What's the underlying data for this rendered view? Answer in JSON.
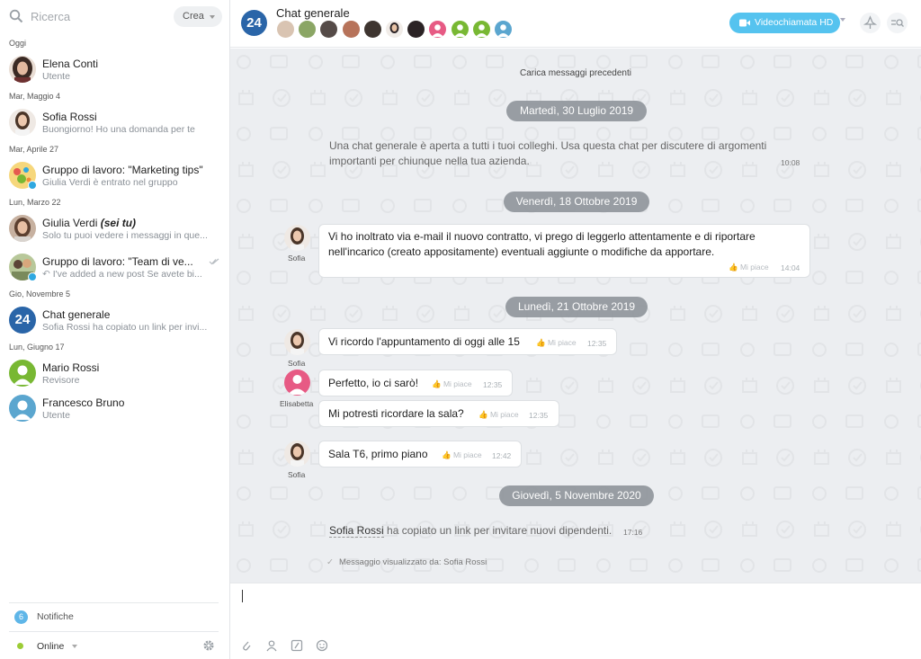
{
  "sidebar": {
    "search_placeholder": "Ricerca",
    "create_label": "Crea",
    "sections": [
      {
        "date": "Oggi"
      },
      {
        "date": "Mar, Maggio 4"
      },
      {
        "date": "Mar, Aprile 27"
      },
      {
        "date": "Lun, Marzo 22"
      },
      {
        "date": "Gio, Novembre 5"
      },
      {
        "date": "Lun, Giugno 17"
      }
    ],
    "chats": [
      {
        "name": "Elena Conti",
        "sub": "Utente",
        "avatar_color": "#6b4a3a"
      },
      {
        "name": "Sofia Rossi",
        "sub": "Buongiorno! Ho una domanda per te",
        "avatar_color": "#d8c8b8"
      },
      {
        "name": "Gruppo di lavoro: \"Marketing tips\"",
        "sub": "Giulia Verdi è entrato nel gruppo",
        "avatar_color": "#f3d27a"
      },
      {
        "name": "Giulia Verdi",
        "name_suffix": "(sei tu)",
        "sub": "Solo tu puoi vedere i messaggi in que...",
        "avatar_color": "#a98a78"
      },
      {
        "name": "Gruppo di lavoro: \"Team di ve...",
        "sub": "I've added a new post Se avete bi...",
        "avatar_color": "#c9b38d"
      },
      {
        "name": "Chat generale",
        "sub": "Sofia Rossi ha copiato un link per invi...",
        "avatar_color": "#2a65a8",
        "avatar_text": "24"
      },
      {
        "name": "Mario Rossi",
        "sub": "Revisore",
        "avatar_color": "#78b833"
      },
      {
        "name": "Francesco Bruno",
        "sub": "Utente",
        "avatar_color": "#5ba6cf"
      }
    ],
    "notifications_count": "6",
    "notifications_label": "Notifiche",
    "status_label": "Online"
  },
  "header": {
    "logo_text": "24",
    "title": "Chat generale",
    "video_label": "Videochiamata HD",
    "member_colors": [
      "#d9c4b2",
      "#8ba665",
      "#554b48",
      "#b7735a",
      "#3e3530",
      "#2e2828",
      "#2b2325",
      "#e75a84",
      "#78b833",
      "#78b833",
      "#5ba6cf"
    ]
  },
  "messages": {
    "load_prev": "Carica messaggi precedenti",
    "dates": [
      "Martedì, 30 Luglio 2019",
      "Venerdì, 18 Ottobre 2019",
      "Lunedì, 21 Ottobre 2019",
      "Giovedì, 5 Novembre 2020"
    ],
    "system_intro_1": "Una chat generale è aperta a tutti i tuoi colleghi. Usa questa chat per discutere di argomenti",
    "system_intro_2": "importanti per chiunque nella tua azienda.",
    "system_intro_time": "10:08",
    "m1_line1": "Vi ho inoltrato via e-mail il nuovo contratto, vi prego di leggerlo attentamente e di riportare",
    "m1_line2": "nell'incarico (creato appositamente) eventuali aggiunte o modifiche da apportare.",
    "m1_time": "14:04",
    "m2_text": "Vi ricordo l'appuntamento di oggi alle 15",
    "m2_time": "12:35",
    "m3_text": "Perfetto, io ci sarò!",
    "m3_time": "12:35",
    "m4_text": "Mi potresti ricordare la sala?",
    "m4_time": "12:35",
    "m5_text": "Sala T6, primo piano",
    "m5_time": "12:42",
    "like_label": "Mi piace",
    "sender_sofia": "Sofia",
    "sender_elisabetta": "Elisabetta",
    "sys_link_name": "Sofia Rossi",
    "sys_link_rest": "ha copiato un link per invitare nuovi dipendenti.",
    "sys_link_time": "17:16",
    "seen_label": "Messaggio visualizzato da: Sofia Rossi"
  },
  "colors": {
    "accent": "#55c3ef",
    "brand": "#2a65a8",
    "online": "#9ccc36",
    "date_pill": "#8f959b"
  }
}
